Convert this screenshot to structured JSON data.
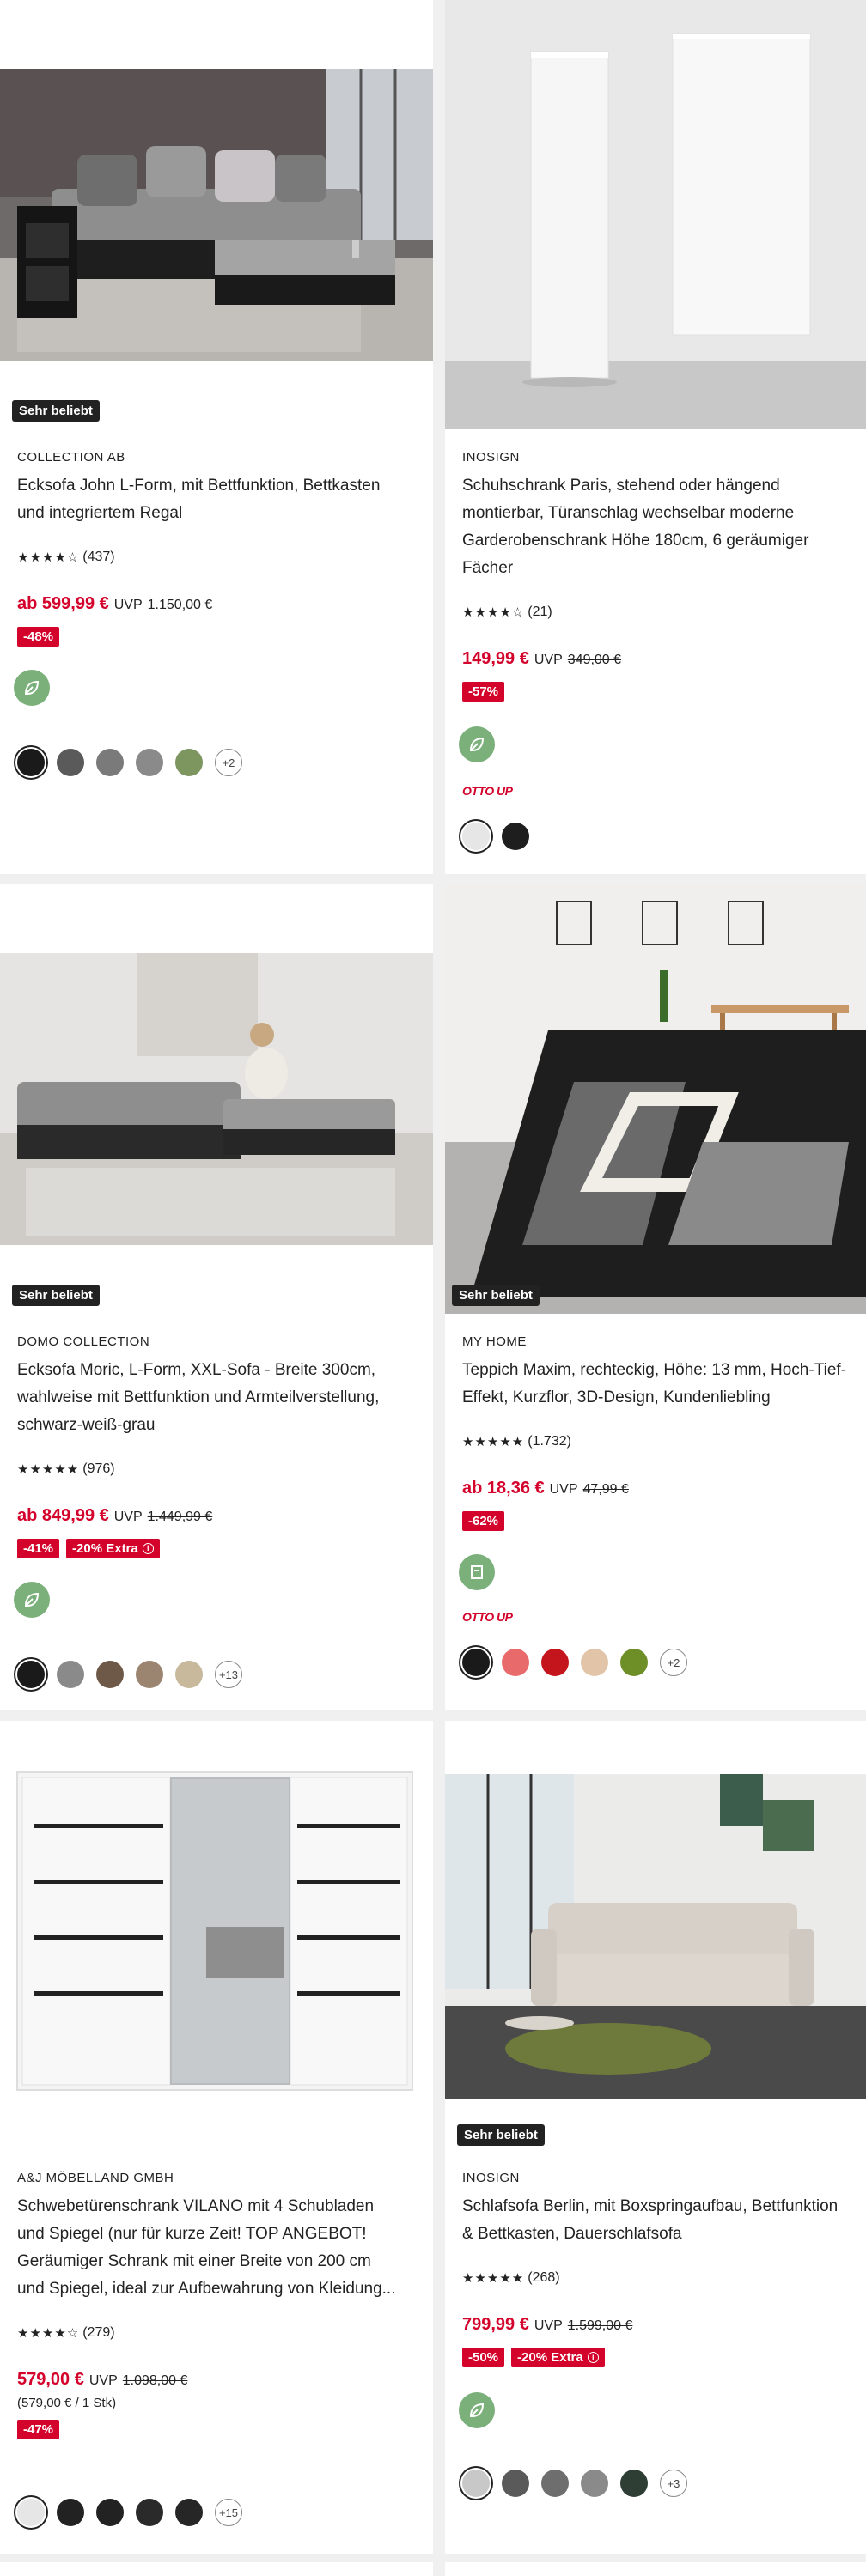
{
  "cards": [
    {
      "badge": "Sehr beliebt",
      "brand": "COLLECTION AB",
      "title_lines": [
        "Ecksofa John L-Form, mit Bettfunktion, Bettkasten",
        "und integriertem Regal"
      ],
      "stars": "★★★★☆",
      "reviews": "(437)",
      "price": "ab 599,99 €",
      "uvp_label": "UVP",
      "uvp_value": "1.150,00 €",
      "discounts": [
        "-48%"
      ],
      "swatch_colors": [
        "#1a1a1a",
        "#5a5a5a",
        "#7a7a7a",
        "#8a8a8a",
        "#7d9660"
      ],
      "swatch_more": "+2",
      "image_icon": "corner-sofa-image"
    },
    {
      "badge": "",
      "brand": "INOSIGN",
      "title_lines": [
        "Schuhschrank Paris, stehend oder hängend",
        "montierbar, Türanschlag wechselbar moderne",
        "Garderobenschrank Höhe 180cm, 6 geräumiger",
        "Fächer"
      ],
      "stars": "★★★★☆",
      "reviews": "(21)",
      "price": "149,99 €",
      "uvp_label": "UVP",
      "uvp_value": "349,00 €",
      "discounts": [
        "-57%"
      ],
      "otto_up": "OTTO UP",
      "swatch_colors": [
        "#e6e6e6",
        "#1e1e1e"
      ],
      "swatch_more": "",
      "image_icon": "wardrobe-image"
    },
    {
      "badge": "Sehr beliebt",
      "brand": "DOMO COLLECTION",
      "title_lines": [
        "Ecksofa Moric, L-Form, XXL-Sofa - Breite 300cm,",
        "wahlweise mit Bettfunktion und Armteilverstellung,",
        "schwarz-weiß-grau"
      ],
      "stars": "★★★★★",
      "reviews": "(976)",
      "price": "ab 849,99 €",
      "uvp_label": "UVP",
      "uvp_value": "1.449,99 €",
      "discounts": [
        "-41%",
        "-20% Extra"
      ],
      "swatch_colors": [
        "#1a1a1a",
        "#8a8a8a",
        "#6e5848",
        "#9b8570",
        "#c8b89c"
      ],
      "swatch_more": "+13",
      "image_icon": "xxl-sofa-image"
    },
    {
      "badge": "Sehr beliebt",
      "brand": "MY HOME",
      "title_lines": [
        "Teppich Maxim, rechteckig, Höhe: 13 mm, Hoch-Tief-",
        "Effekt, Kurzflor, 3D-Design, Kundenliebling"
      ],
      "stars": "★★★★★",
      "reviews": "(1.732)",
      "price": "ab 18,36 €",
      "uvp_label": "UVP",
      "uvp_value": "47,99 €",
      "discounts": [
        "-62%"
      ],
      "otto_up": "OTTO UP",
      "swatch_colors": [
        "#1a1a1a",
        "#e86a6a",
        "#c4141c",
        "#e2c4a8",
        "#6e8e28"
      ],
      "swatch_more": "+2",
      "image_icon": "rug-image"
    },
    {
      "badge": "",
      "brand": "A&J MÖBELLAND GMBH",
      "title_lines": [
        "Schwebetürenschrank VILANO mit 4 Schubladen",
        "und Spiegel (nur für kurze Zeit! TOP ANGEBOT!",
        "Geräumiger Schrank mit einer Breite von 200 cm",
        "und Spiegel, ideal zur Aufbewahrung von Kleidung..."
      ],
      "stars": "★★★★☆",
      "reviews": "(279)",
      "price": "579,00 €",
      "uvp_label": "UVP",
      "uvp_value": "1.098,00 €",
      "unit_price": "(579,00 € / 1 Stk)",
      "discounts": [
        "-47%"
      ],
      "swatch_colors": [
        "#e6e6e6",
        "#222222",
        "#222222",
        "#2a2a2a",
        "#262626"
      ],
      "swatch_more": "+15",
      "image_icon": "sliding-wardrobe-image"
    },
    {
      "badge": "Sehr beliebt",
      "brand": "INOSIGN",
      "title_lines": [
        "Schlafsofa Berlin, mit Boxspringaufbau, Bettfunktion",
        "& Bettkasten, Dauerschlafsofa"
      ],
      "stars": "★★★★★",
      "reviews": "(268)",
      "price": "799,99 €",
      "uvp_label": "UVP",
      "uvp_value": "1.599,00 €",
      "discounts": [
        "-50%",
        "-20% Extra"
      ],
      "swatch_colors": [
        "#c8c8c8",
        "#5a5a5a",
        "#6e6e6e",
        "#8a8a8a",
        "#2e3e34"
      ],
      "swatch_more": "+3",
      "image_icon": "sleeper-sofa-image"
    }
  ]
}
